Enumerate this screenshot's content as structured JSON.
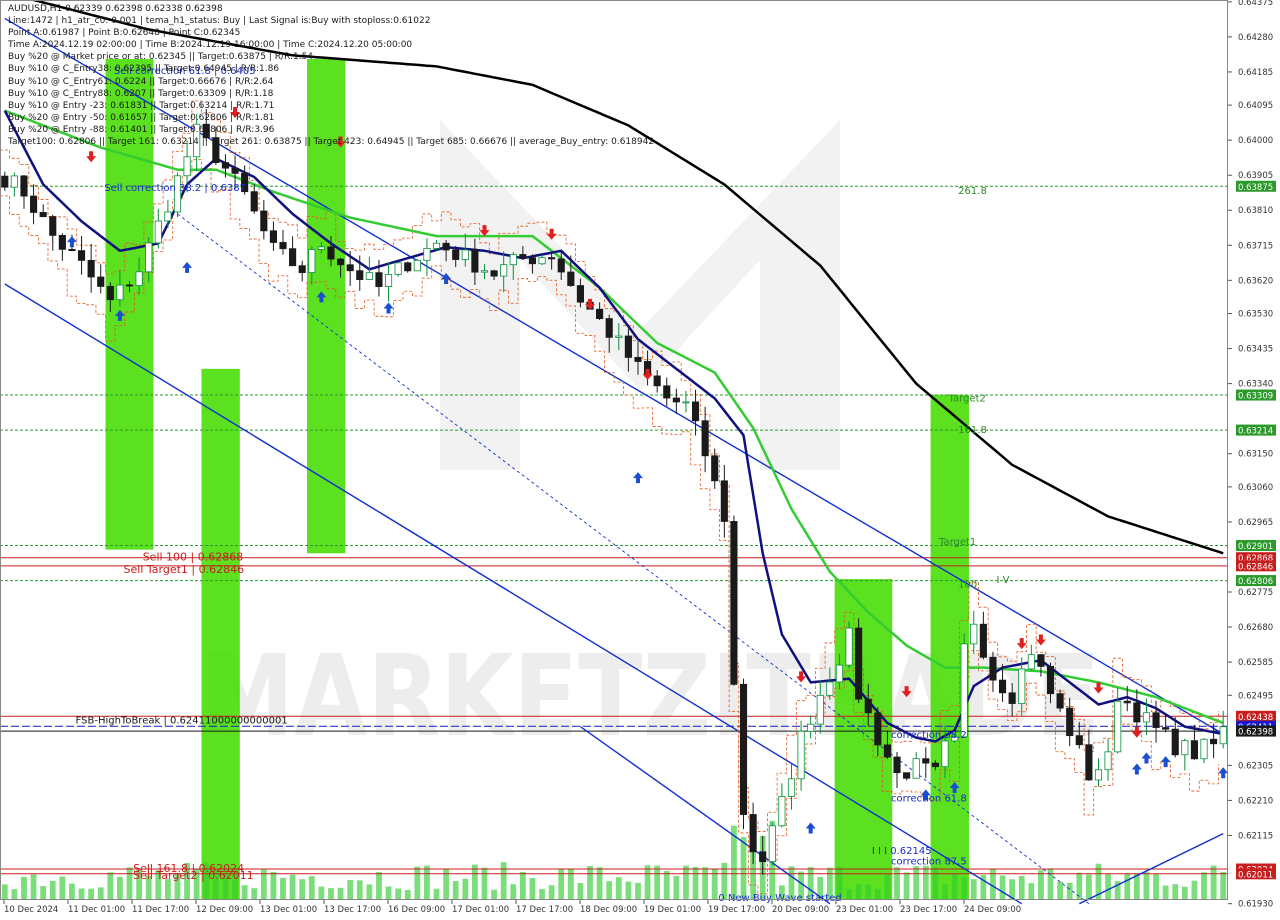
{
  "info_lines": [
    "AUDUSD,H1  0.62339 0.62398 0.62338 0.62398",
    "Line:1472 | h1_atr_c0: 0.001 | tema_h1_status: Buy | Last Signal is:Buy with stoploss:0.61022",
    "Point A:0.61987 | Point B:0.62648 | Point C:0.62345",
    "Time A:2024.12.19 02:00:00 | Time B:2024.12.19 16:00:00 | Time C:2024.12.20 05:00:00",
    "Buy %20 @ Market price or at: 0.62345 || Target:0.63875 | R/R:1.54",
    "Buy %10 @ C_Entry38: 0.62395 || Target:0.64945 | R/R:1.86",
    "Buy %10 @ C_Entry61: 0.6224 || Target:0.66676 | R/R:2.64",
    "Buy %10 @ C_Entry88: 0.6207 || Target:0.63309 | R/R:1.18",
    "Buy %10 @ Entry -23: 0.61831 || Target:0.63214 | R/R:1.71",
    "Buy %20 @ Entry -50: 0.61657 || Target:0.62806 | R/R:1.81",
    "Buy %20 @ Entry -88: 0.61401 || Target:0.62806 | R/R:3.96",
    "Target100: 0.62806 || Target 161: 0.63214 || Target 261: 0.63875 || Target 423: 0.64945 || Target 685: 0.66676 || average_Buy_entry: 0.618942"
  ],
  "watermark": "MARKETZITRADE",
  "colors": {
    "up": "#0a8f3c",
    "down": "#1a1a1a",
    "ma_green": "#33cc33",
    "ma_navy": "#101080",
    "ma_black": "#000000",
    "trend_blue": "#1030d0",
    "green_level": "#2a9a2a",
    "red_level": "#c81e1e",
    "blue_level": "#1a1acc",
    "bar_green": "#44dd00",
    "vol": "#33cc33",
    "signal_up": "#1a4fd0",
    "signal_down": "#e02020",
    "stair_orange": "#e05a1e"
  },
  "chart_data": {
    "type": "candlestick",
    "symbol": "AUDUSD",
    "timeframe": "H1",
    "ylim": [
      0.6194,
      0.6438
    ],
    "price_ticks": [
      "0.64375",
      "0.64280",
      "0.64185",
      "0.64095",
      "0.64000",
      "0.63905",
      "0.63810",
      "0.63715",
      "0.63620",
      "0.63530",
      "0.63435",
      "0.63340",
      "0.63150",
      "0.63060",
      "0.62965",
      "0.62775",
      "0.62680",
      "0.62585",
      "0.62495",
      "0.62305",
      "0.62210",
      "0.62115",
      "0.61930"
    ],
    "time_labels": [
      "10 Dec 2024",
      "11 Dec 01:00",
      "11 Dec 17:00",
      "12 Dec 09:00",
      "13 Dec 01:00",
      "13 Dec 17:00",
      "16 Dec 09:00",
      "17 Dec 01:00",
      "17 Dec 17:00",
      "18 Dec 09:00",
      "19 Dec 01:00",
      "19 Dec 17:00",
      "20 Dec 09:00",
      "23 Dec 01:00",
      "23 Dec 17:00",
      "24 Dec 09:00"
    ],
    "anchors": [
      [
        0,
        0.639
      ],
      [
        2,
        0.6386
      ],
      [
        5,
        0.6374
      ],
      [
        8,
        0.6366
      ],
      [
        11,
        0.6356
      ],
      [
        14,
        0.6365
      ],
      [
        17,
        0.6383
      ],
      [
        20,
        0.6402
      ],
      [
        22,
        0.6396
      ],
      [
        25,
        0.6385
      ],
      [
        28,
        0.637
      ],
      [
        31,
        0.6365
      ],
      [
        33,
        0.6372
      ],
      [
        36,
        0.6365
      ],
      [
        39,
        0.636
      ],
      [
        42,
        0.6367
      ],
      [
        45,
        0.6372
      ],
      [
        48,
        0.6368
      ],
      [
        51,
        0.6364
      ],
      [
        54,
        0.6368
      ],
      [
        57,
        0.6369
      ],
      [
        60,
        0.6357
      ],
      [
        63,
        0.6348
      ],
      [
        66,
        0.6338
      ],
      [
        69,
        0.633
      ],
      [
        71,
        0.6328
      ],
      [
        73,
        0.6315
      ],
      [
        75,
        0.6298
      ],
      [
        76,
        0.6252
      ],
      [
        77,
        0.6218
      ],
      [
        78,
        0.6208
      ],
      [
        79,
        0.6205
      ],
      [
        81,
        0.622
      ],
      [
        83,
        0.6238
      ],
      [
        85,
        0.625
      ],
      [
        87,
        0.626
      ],
      [
        88,
        0.6265
      ],
      [
        89,
        0.625
      ],
      [
        91,
        0.6238
      ],
      [
        93,
        0.6228
      ],
      [
        95,
        0.623
      ],
      [
        97,
        0.6228
      ],
      [
        98,
        0.6235
      ],
      [
        99,
        0.6236
      ],
      [
        100,
        0.6262
      ],
      [
        101,
        0.627
      ],
      [
        103,
        0.6255
      ],
      [
        105,
        0.625
      ],
      [
        107,
        0.6262
      ],
      [
        109,
        0.625
      ],
      [
        111,
        0.624
      ],
      [
        113,
        0.6228
      ],
      [
        115,
        0.6232
      ],
      [
        116,
        0.625
      ],
      [
        118,
        0.6245
      ],
      [
        120,
        0.624
      ],
      [
        122,
        0.6236
      ],
      [
        124,
        0.6234
      ],
      [
        126,
        0.6236
      ],
      [
        127,
        0.624
      ]
    ],
    "bar_count": 128,
    "moving_averages": [
      {
        "color": "ma_black",
        "points": [
          [
            0,
            0.644
          ],
          [
            15,
            0.643
          ],
          [
            30,
            0.6423
          ],
          [
            45,
            0.642
          ],
          [
            55,
            0.6415
          ],
          [
            65,
            0.6404
          ],
          [
            75,
            0.6388
          ],
          [
            85,
            0.6366
          ],
          [
            95,
            0.6334
          ],
          [
            105,
            0.6312
          ],
          [
            115,
            0.6298
          ],
          [
            127,
            0.6288
          ]
        ]
      },
      {
        "color": "ma_green",
        "points": [
          [
            0,
            0.6408
          ],
          [
            10,
            0.6398
          ],
          [
            18,
            0.6392
          ],
          [
            22,
            0.6392
          ],
          [
            28,
            0.6386
          ],
          [
            36,
            0.6379
          ],
          [
            45,
            0.6374
          ],
          [
            55,
            0.6374
          ],
          [
            62,
            0.636
          ],
          [
            68,
            0.6345
          ],
          [
            74,
            0.6337
          ],
          [
            78,
            0.6322
          ],
          [
            82,
            0.63
          ],
          [
            86,
            0.6283
          ],
          [
            90,
            0.6272
          ],
          [
            94,
            0.6263
          ],
          [
            98,
            0.6257
          ],
          [
            102,
            0.6257
          ],
          [
            108,
            0.6256
          ],
          [
            114,
            0.6253
          ],
          [
            120,
            0.6249
          ],
          [
            127,
            0.6242
          ]
        ]
      },
      {
        "color": "ma_navy",
        "points": [
          [
            0,
            0.6408
          ],
          [
            4,
            0.6388
          ],
          [
            8,
            0.6378
          ],
          [
            12,
            0.637
          ],
          [
            16,
            0.6372
          ],
          [
            19,
            0.6388
          ],
          [
            22,
            0.6395
          ],
          [
            26,
            0.639
          ],
          [
            30,
            0.638
          ],
          [
            34,
            0.6372
          ],
          [
            38,
            0.6365
          ],
          [
            42,
            0.6368
          ],
          [
            46,
            0.6371
          ],
          [
            50,
            0.637
          ],
          [
            54,
            0.6368
          ],
          [
            58,
            0.637
          ],
          [
            62,
            0.636
          ],
          [
            66,
            0.6346
          ],
          [
            70,
            0.6338
          ],
          [
            74,
            0.633
          ],
          [
            77,
            0.632
          ],
          [
            79,
            0.6288
          ],
          [
            81,
            0.6266
          ],
          [
            84,
            0.6253
          ],
          [
            88,
            0.6254
          ],
          [
            92,
            0.6242
          ],
          [
            95,
            0.6238
          ],
          [
            97,
            0.6237
          ],
          [
            99,
            0.624
          ],
          [
            101,
            0.6252
          ],
          [
            104,
            0.6257
          ],
          [
            108,
            0.6259
          ],
          [
            111,
            0.6253
          ],
          [
            114,
            0.6247
          ],
          [
            117,
            0.6249
          ],
          [
            120,
            0.6246
          ],
          [
            123,
            0.6241
          ],
          [
            127,
            0.6239
          ]
        ]
      }
    ],
    "horizontal_levels": [
      {
        "price": 0.63875,
        "label": "0.63875",
        "color": "green_level"
      },
      {
        "price": 0.63309,
        "label": "0.63309",
        "color": "green_level"
      },
      {
        "price": 0.63214,
        "label": "0.63214",
        "color": "green_level"
      },
      {
        "price": 0.62901,
        "label": "0.62901",
        "color": "green_level"
      },
      {
        "price": 0.62868,
        "label": "0.62868",
        "color": "red_level"
      },
      {
        "price": 0.62846,
        "label": "0.62846",
        "color": "red_level"
      },
      {
        "price": 0.62806,
        "label": "0.62806",
        "color": "green_level"
      },
      {
        "price": 0.62438,
        "label": "0.62438",
        "color": "red_level"
      },
      {
        "price": 0.62411,
        "label": "0.62411",
        "color": "blue_level"
      },
      {
        "price": 0.62398,
        "label": "0.62398",
        "color": "down"
      },
      {
        "price": 0.62024,
        "label": "0.62024",
        "color": "red_level"
      },
      {
        "price": 0.62011,
        "label": "0.62011",
        "color": "red_level"
      }
    ],
    "green_zones": [
      {
        "x0": 11,
        "x1": 16,
        "top": 0.6422,
        "bottom": 0.6289
      },
      {
        "x0": 32,
        "x1": 36,
        "top": 0.6422,
        "bottom": 0.6288
      },
      {
        "x0": 21,
        "x1": 25,
        "top": 0.6338,
        "bottom": 0.6194
      },
      {
        "x0": 87,
        "x1": 93,
        "top": 0.6281,
        "bottom": 0.6194
      },
      {
        "x0": 97,
        "x1": 101,
        "top": 0.6331,
        "bottom": 0.6194
      }
    ],
    "level_texts": [
      {
        "text": "261.8",
        "price": 0.63862,
        "bar": 100
      },
      {
        "text": "Target2",
        "price": 0.633,
        "bar": 99
      },
      {
        "text": "161.8",
        "price": 0.63214,
        "bar": 100
      },
      {
        "text": "Target1",
        "price": 0.6291,
        "bar": 98
      },
      {
        "text": "100",
        "price": 0.62796,
        "bar": 100
      },
      {
        "text": "I V",
        "price": 0.62808,
        "bar": 104
      },
      {
        "text": "Sell correction 38.2 | 0.6387",
        "price": 0.6387,
        "bar": 11
      },
      {
        "text": "Sell correction 61.8 | 0.6405",
        "price": 0.64188,
        "bar": 12
      },
      {
        "text": "FSB-HighToBreak | 0.62411000000000001",
        "price": 0.62426,
        "bar": 8
      },
      {
        "text": "correction 38.2",
        "price": 0.62388,
        "bar": 93
      },
      {
        "text": "correction 61.8",
        "price": 0.62215,
        "bar": 93
      },
      {
        "text": "correction 87.5",
        "price": 0.62045,
        "bar": 93
      },
      {
        "text": "I I I 0.62145",
        "price": 0.62073,
        "bar": 91
      },
      {
        "text": "Sell 100 | 0.62868",
        "price": 0.62868,
        "bar": 15
      },
      {
        "text": "Sell Target1 | 0.62846",
        "price": 0.62835,
        "bar": 13
      },
      {
        "text": "Sell 161.8 | 0.62024",
        "price": 0.62024,
        "bar": 14
      },
      {
        "text": "Sell Target2 | 0.62011",
        "price": 0.62005,
        "bar": 14
      },
      {
        "text": "0 New Buy Wave started",
        "price": 0.61945,
        "bar": 75
      }
    ]
  }
}
